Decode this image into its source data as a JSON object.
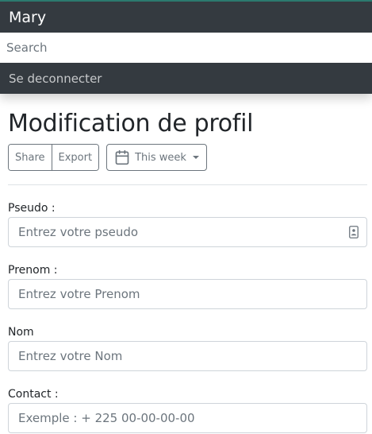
{
  "navbar": {
    "brand": "Mary",
    "search": {
      "placeholder": "Search",
      "value": ""
    },
    "logout_label": "Se deconnecter"
  },
  "page": {
    "title": "Modification de profil"
  },
  "toolbar": {
    "share_label": "Share",
    "export_label": "Export",
    "range_label": "This week",
    "range_icon": "calendar-icon"
  },
  "form": {
    "pseudo": {
      "label": "Pseudo :",
      "placeholder": "Entrez votre pseudo",
      "value": ""
    },
    "prenom": {
      "label": "Prenom :",
      "placeholder": "Entrez votre Prenom",
      "value": ""
    },
    "nom": {
      "label": "Nom",
      "placeholder": "Entrez votre Nom",
      "value": ""
    },
    "contact": {
      "label": "Contact :",
      "placeholder": "Exemple : + 225 00-00-00-00",
      "value": ""
    }
  },
  "colors": {
    "navbar_bg": "#343a40",
    "navbar_accent": "#2b7a6f",
    "button_border": "#6c757d",
    "input_border": "#ced4da"
  }
}
